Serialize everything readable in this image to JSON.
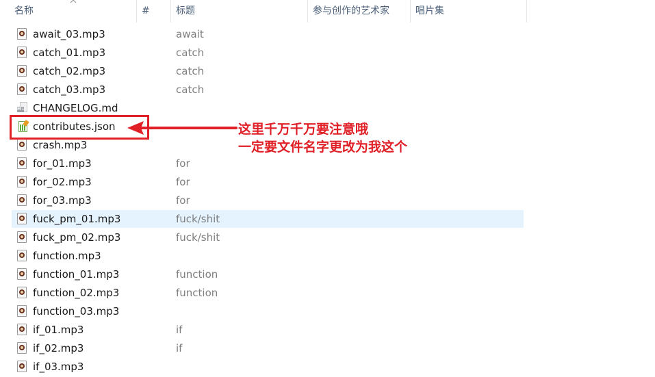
{
  "columns": {
    "name": "名称",
    "number": "#",
    "title": "标题",
    "artist": "参与创作的艺术家",
    "album": "唱片集"
  },
  "files": [
    {
      "name": "await_03.mp3",
      "title": "await",
      "type": "mp3"
    },
    {
      "name": "catch_01.mp3",
      "title": "catch",
      "type": "mp3"
    },
    {
      "name": "catch_02.mp3",
      "title": "catch",
      "type": "mp3"
    },
    {
      "name": "catch_03.mp3",
      "title": "catch",
      "type": "mp3"
    },
    {
      "name": "CHANGELOG.md",
      "title": "",
      "type": "md"
    },
    {
      "name": "contributes.json",
      "title": "",
      "type": "json"
    },
    {
      "name": "crash.mp3",
      "title": "",
      "type": "mp3"
    },
    {
      "name": "for_01.mp3",
      "title": "for",
      "type": "mp3"
    },
    {
      "name": "for_02.mp3",
      "title": "for",
      "type": "mp3"
    },
    {
      "name": "for_03.mp3",
      "title": "for",
      "type": "mp3"
    },
    {
      "name": "fuck_pm_01.mp3",
      "title": "fuck/shit",
      "type": "mp3",
      "selected": true
    },
    {
      "name": "fuck_pm_02.mp3",
      "title": "fuck/shit",
      "type": "mp3"
    },
    {
      "name": "function.mp3",
      "title": "",
      "type": "mp3"
    },
    {
      "name": "function_01.mp3",
      "title": "function",
      "type": "mp3"
    },
    {
      "name": "function_02.mp3",
      "title": "function",
      "type": "mp3"
    },
    {
      "name": "function_03.mp3",
      "title": "",
      "type": "mp3"
    },
    {
      "name": "if_01.mp3",
      "title": "if",
      "type": "mp3"
    },
    {
      "name": "if_02.mp3",
      "title": "if",
      "type": "mp3"
    },
    {
      "name": "if_03.mp3",
      "title": "",
      "type": "mp3"
    }
  ],
  "annotation": {
    "line1": "这里千万千万要注意哦",
    "line2": "一定要文件名字更改为我这个",
    "color": "#e01f26"
  },
  "icons": {
    "mp3": "audio-file-icon",
    "md": "markdown-file-icon",
    "json": "json-file-icon",
    "sort": "sort-up-arrow-icon",
    "arrow": "red-arrow-icon"
  }
}
